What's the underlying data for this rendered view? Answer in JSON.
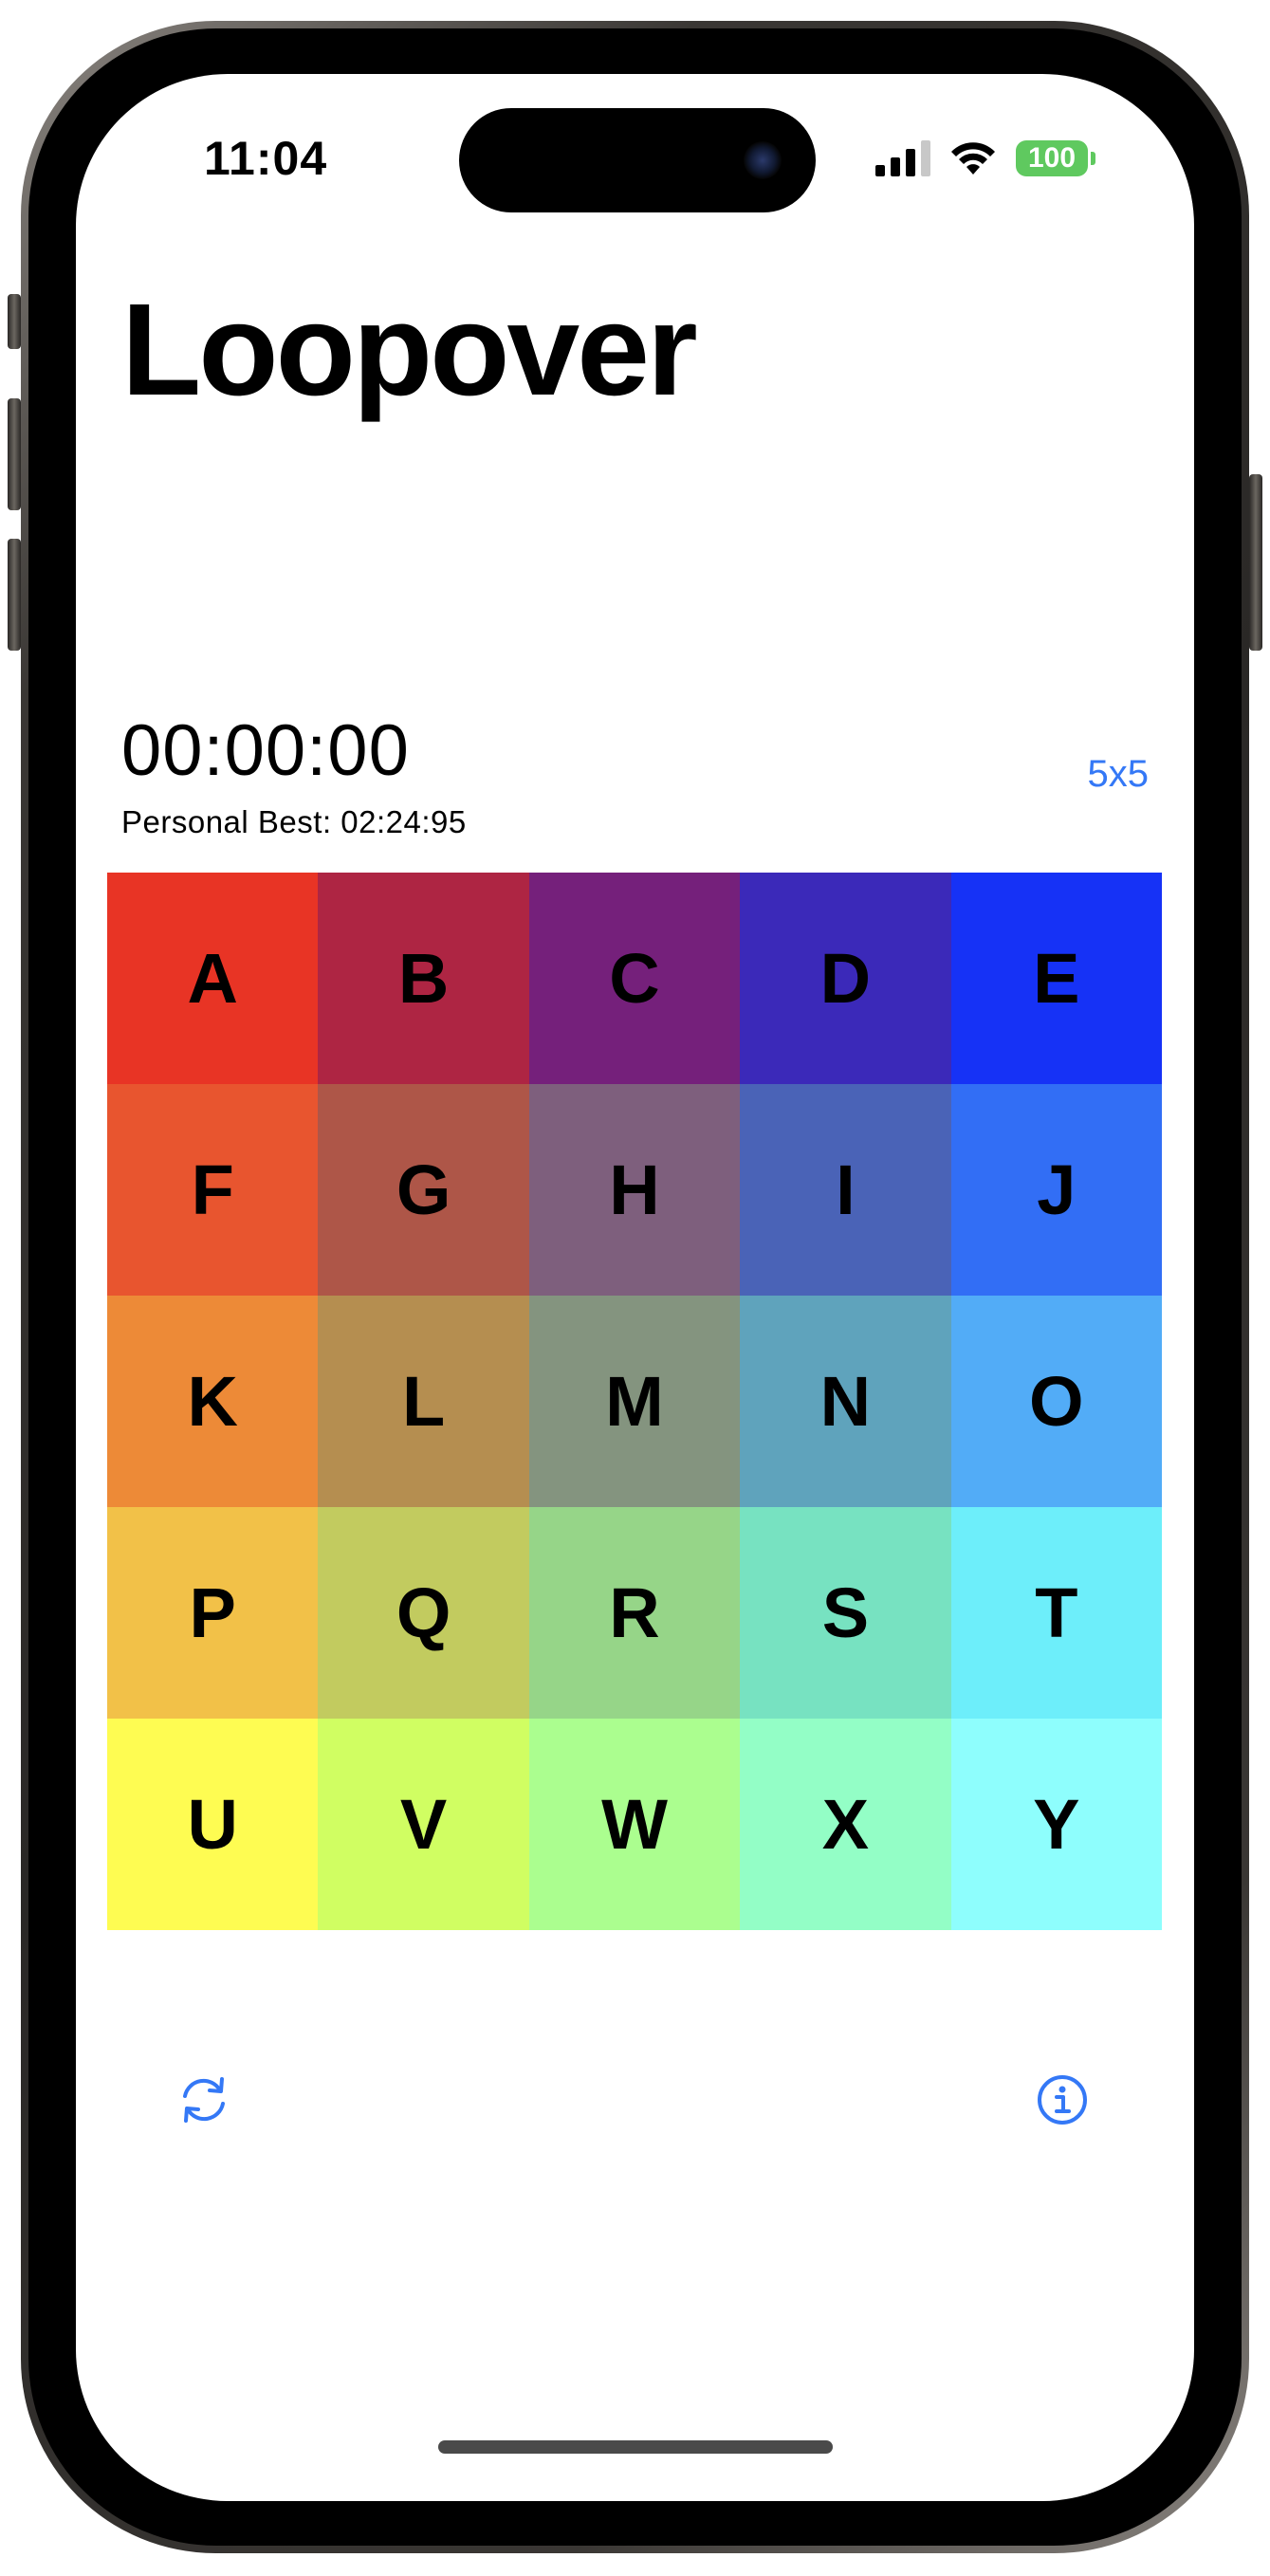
{
  "status_bar": {
    "time": "11:04",
    "battery": "100",
    "icons": [
      "cellular-signal-icon",
      "wifi-icon",
      "battery-icon"
    ]
  },
  "app": {
    "title": "Loopover",
    "timer": "00:00:00",
    "personal_best": "Personal Best: 02:24:95",
    "size_button": "5x5",
    "accent_color": "#3478f6"
  },
  "grid": {
    "rows": 5,
    "cols": 5,
    "tiles": [
      {
        "label": "A",
        "color": "#e83425"
      },
      {
        "label": "B",
        "color": "#ae2543"
      },
      {
        "label": "C",
        "color": "#75207b"
      },
      {
        "label": "D",
        "color": "#3b29b9"
      },
      {
        "label": "E",
        "color": "#1632f6"
      },
      {
        "label": "F",
        "color": "#e8552f"
      },
      {
        "label": "G",
        "color": "#ae5648"
      },
      {
        "label": "H",
        "color": "#7e5f7d"
      },
      {
        "label": "I",
        "color": "#4a63b7"
      },
      {
        "label": "J",
        "color": "#326ef5"
      },
      {
        "label": "K",
        "color": "#ed8a37"
      },
      {
        "label": "L",
        "color": "#b58e50"
      },
      {
        "label": "M",
        "color": "#84947f"
      },
      {
        "label": "N",
        "color": "#5fa3bc"
      },
      {
        "label": "O",
        "color": "#52acf7"
      },
      {
        "label": "P",
        "color": "#f2c148"
      },
      {
        "label": "Q",
        "color": "#c2cb5f"
      },
      {
        "label": "R",
        "color": "#96d588"
      },
      {
        "label": "S",
        "color": "#77e2c1"
      },
      {
        "label": "T",
        "color": "#6deefa"
      },
      {
        "label": "U",
        "color": "#fefc52"
      },
      {
        "label": "V",
        "color": "#d0fe62"
      },
      {
        "label": "W",
        "color": "#abfe8f"
      },
      {
        "label": "X",
        "color": "#93fec6"
      },
      {
        "label": "Y",
        "color": "#8efefd"
      }
    ]
  },
  "toolbar": {
    "shuffle_icon": "shuffle-icon",
    "info_icon": "info-icon"
  }
}
